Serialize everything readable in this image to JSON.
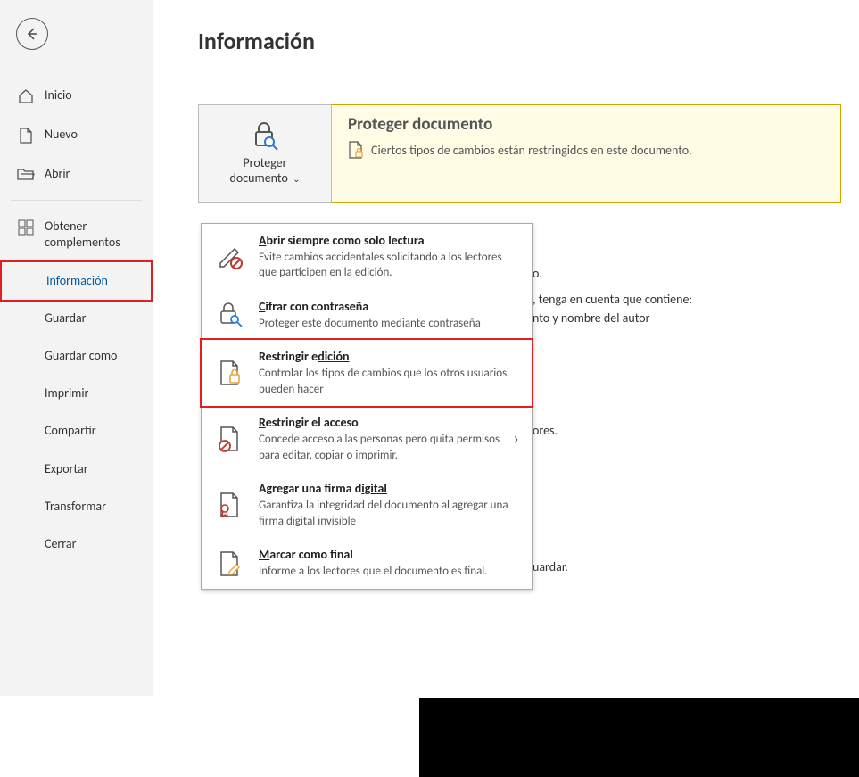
{
  "page_title": "Información",
  "sidebar": {
    "items": [
      {
        "label": "Inicio"
      },
      {
        "label": "Nuevo"
      },
      {
        "label": "Abrir"
      },
      {
        "label": "Obtener complementos"
      },
      {
        "label": "Información"
      },
      {
        "label": "Guardar"
      },
      {
        "label": "Guardar como"
      },
      {
        "label": "Imprimir"
      },
      {
        "label": "Compartir"
      },
      {
        "label": "Exportar"
      },
      {
        "label": "Transformar"
      },
      {
        "label": "Cerrar"
      }
    ]
  },
  "protect": {
    "button_label_line1": "Proteger",
    "button_label_line2": "documento",
    "heading": "Proteger documento",
    "message": "Ciertos tipos de cambios están restringidos en este documento."
  },
  "dropdown": {
    "items": [
      {
        "title_pre": "A",
        "title_rest": "brir siempre como solo lectura",
        "desc": "Evite cambios accidentales solicitando a los lectores que participen en la edición."
      },
      {
        "title_pre": "C",
        "title_rest": "ifrar con contraseña",
        "desc": "Proteger este documento mediante contraseña"
      },
      {
        "title_pre": "Restringir e",
        "title_rest": "dición",
        "title_underline_mid": true,
        "desc": "Controlar los tipos de cambios que los otros usuarios pueden hacer"
      },
      {
        "title_pre": "R",
        "title_rest": "estringir el acceso",
        "desc": "Concede acceso a las personas pero quita permisos para editar, copiar o imprimir.",
        "has_submenu": true
      },
      {
        "title_pre": "Agregar una firma d",
        "title_rest": "igital",
        "title_underline_mid": true,
        "desc": "Garantiza la integridad del documento al agregar una firma digital invisible"
      },
      {
        "title_pre": "M",
        "title_rest": "arcar como final",
        "desc": "Informe a los lectores que el documento es final."
      }
    ]
  },
  "behind": {
    "line1": "o.",
    "line2": ", tenga en cuenta que contiene:",
    "line3": "nto y nombre del autor",
    "line4": "ores.",
    "line5": "uardar."
  }
}
